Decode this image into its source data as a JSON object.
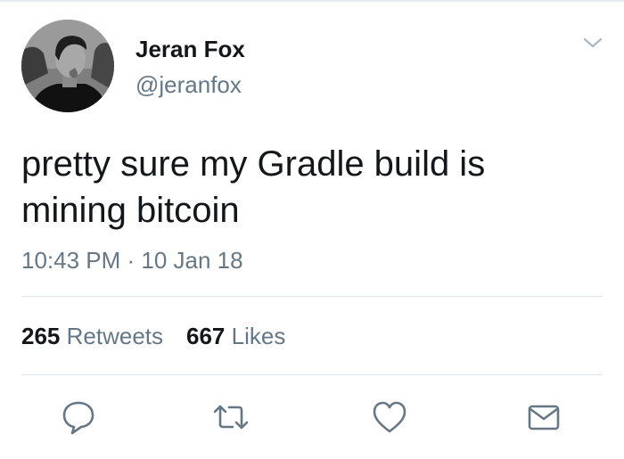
{
  "author": {
    "display_name": "Jeran Fox",
    "handle": "@jeranfox",
    "avatar_icon": "user-avatar-photo"
  },
  "tweet": {
    "text": "pretty sure my Gradle build is mining bitcoin",
    "timestamp": "10:43 PM · 10 Jan 18"
  },
  "stats": {
    "retweets_count": "265",
    "retweets_label": "Retweets",
    "likes_count": "667",
    "likes_label": "Likes"
  },
  "actions": [
    {
      "name": "reply",
      "icon": "speech-bubble-icon"
    },
    {
      "name": "retweet",
      "icon": "retweet-arrows-icon"
    },
    {
      "name": "like",
      "icon": "heart-icon"
    },
    {
      "name": "direct-message",
      "icon": "envelope-icon"
    }
  ],
  "menu_icon": "chevron-down-icon",
  "colors": {
    "primary_text": "#14171a",
    "secondary_text": "#657786",
    "divider": "#e1e8ed",
    "icon": "#657786"
  }
}
